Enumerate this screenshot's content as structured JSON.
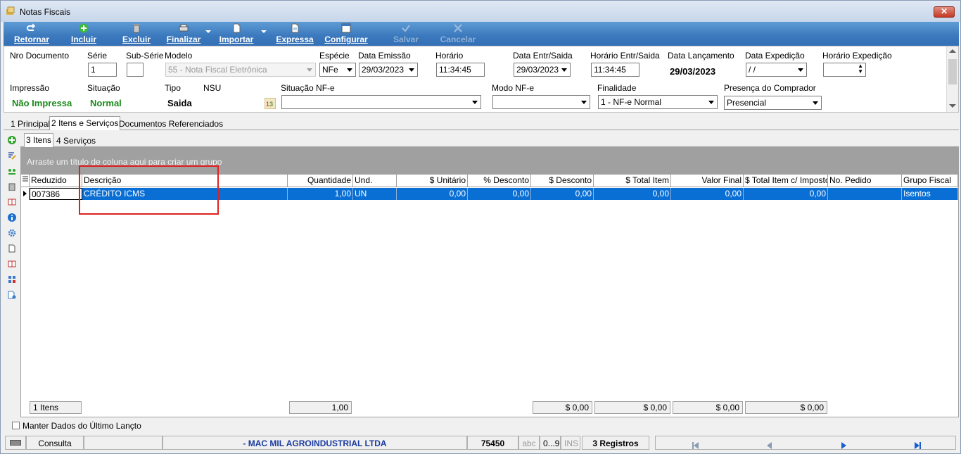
{
  "window": {
    "title": "Notas Fiscais",
    "close": "✕"
  },
  "toolbar": {
    "retornar": "Retornar",
    "incluir": "Incluir",
    "excluir": "Excluir",
    "finalizar": "Finalizar",
    "importar": "Importar",
    "expressa": "Expressa",
    "configurar": "Configurar",
    "salvar": "Salvar",
    "cancelar": "Cancelar"
  },
  "form": {
    "nro_documento_label": "Nro Documento",
    "serie_label": "Série",
    "serie_value": "1",
    "subserie_label": "Sub-Série",
    "subserie_value": "",
    "modelo_label": "Modelo",
    "modelo_value": "55 - Nota Fiscal Eletrônica",
    "especie_label": "Espécie",
    "especie_value": "NFe",
    "data_emissao_label": "Data Emissão",
    "data_emissao_value": "29/03/2023",
    "horario_label": "Horário",
    "horario_value": "11:34:45",
    "data_entr_label": "Data Entr/Saida",
    "data_entr_value": "29/03/2023",
    "horario_entr_label": "Horário Entr/Saida",
    "horario_entr_value": "11:34:45",
    "data_lanc_label": "Data Lançamento",
    "data_lanc_value": "29/03/2023",
    "data_exp_label": "Data Expedição",
    "data_exp_value": " / /",
    "horario_exp_label": "Horário Expedição",
    "horario_exp_value": "",
    "impressao_label": "Impressão",
    "impressao_value": "Não Impressa",
    "situacao_label": "Situação",
    "situacao_value": "Normal",
    "tipo_label": "Tipo",
    "tipo_value": "Saida",
    "nsu_label": "NSU",
    "situacao_nfe_label": "Situação NF-e",
    "situacao_nfe_value": "",
    "modo_nfe_label": "Modo NF-e",
    "modo_nfe_value": "",
    "finalidade_label": "Finalidade",
    "finalidade_value": "1 - NF-e Normal",
    "presenca_label": "Presença do Comprador",
    "presenca_value": "Presencial"
  },
  "tabs": {
    "principal": "1 Principal",
    "itens_servicos": "2 Itens e Serviços",
    "docs_ref": "Documentos Referenciados",
    "itens": "3 Itens",
    "servicos": "4 Serviços"
  },
  "grid": {
    "group_hint": "Arraste um título de coluna aqui para criar um grupo",
    "columns": [
      "Reduzido",
      "Descrição",
      "Quantidade",
      "Und.",
      "$ Unitário",
      "% Desconto",
      "$ Desconto",
      "$ Total Item",
      "Valor Final",
      "$ Total Item c/ Impostos",
      "No. Pedido",
      "Grupo Fiscal"
    ],
    "rows": [
      [
        "007386",
        "CRÉDITO ICMS",
        "1,00",
        "UN",
        "0,00",
        "0,00",
        "0,00",
        "0,00",
        "0,00",
        "0,00",
        "",
        "Isentos"
      ]
    ],
    "footer": {
      "count": "1 Itens",
      "quantidade": "1,00",
      "desconto": "$ 0,00",
      "total_item": "$ 0,00",
      "valor_final": "$ 0,00",
      "total_impostos": "$ 0,00"
    }
  },
  "bottom": {
    "keep_label": "Manter Dados do Último Lançto",
    "consulta": "Consulta",
    "company": "- MAC MIL AGROINDUSTRIAL  LTDA",
    "code": "75450",
    "abc": "abc",
    "range": "0...9",
    "ins": "INS",
    "registros": "3 Registros"
  }
}
